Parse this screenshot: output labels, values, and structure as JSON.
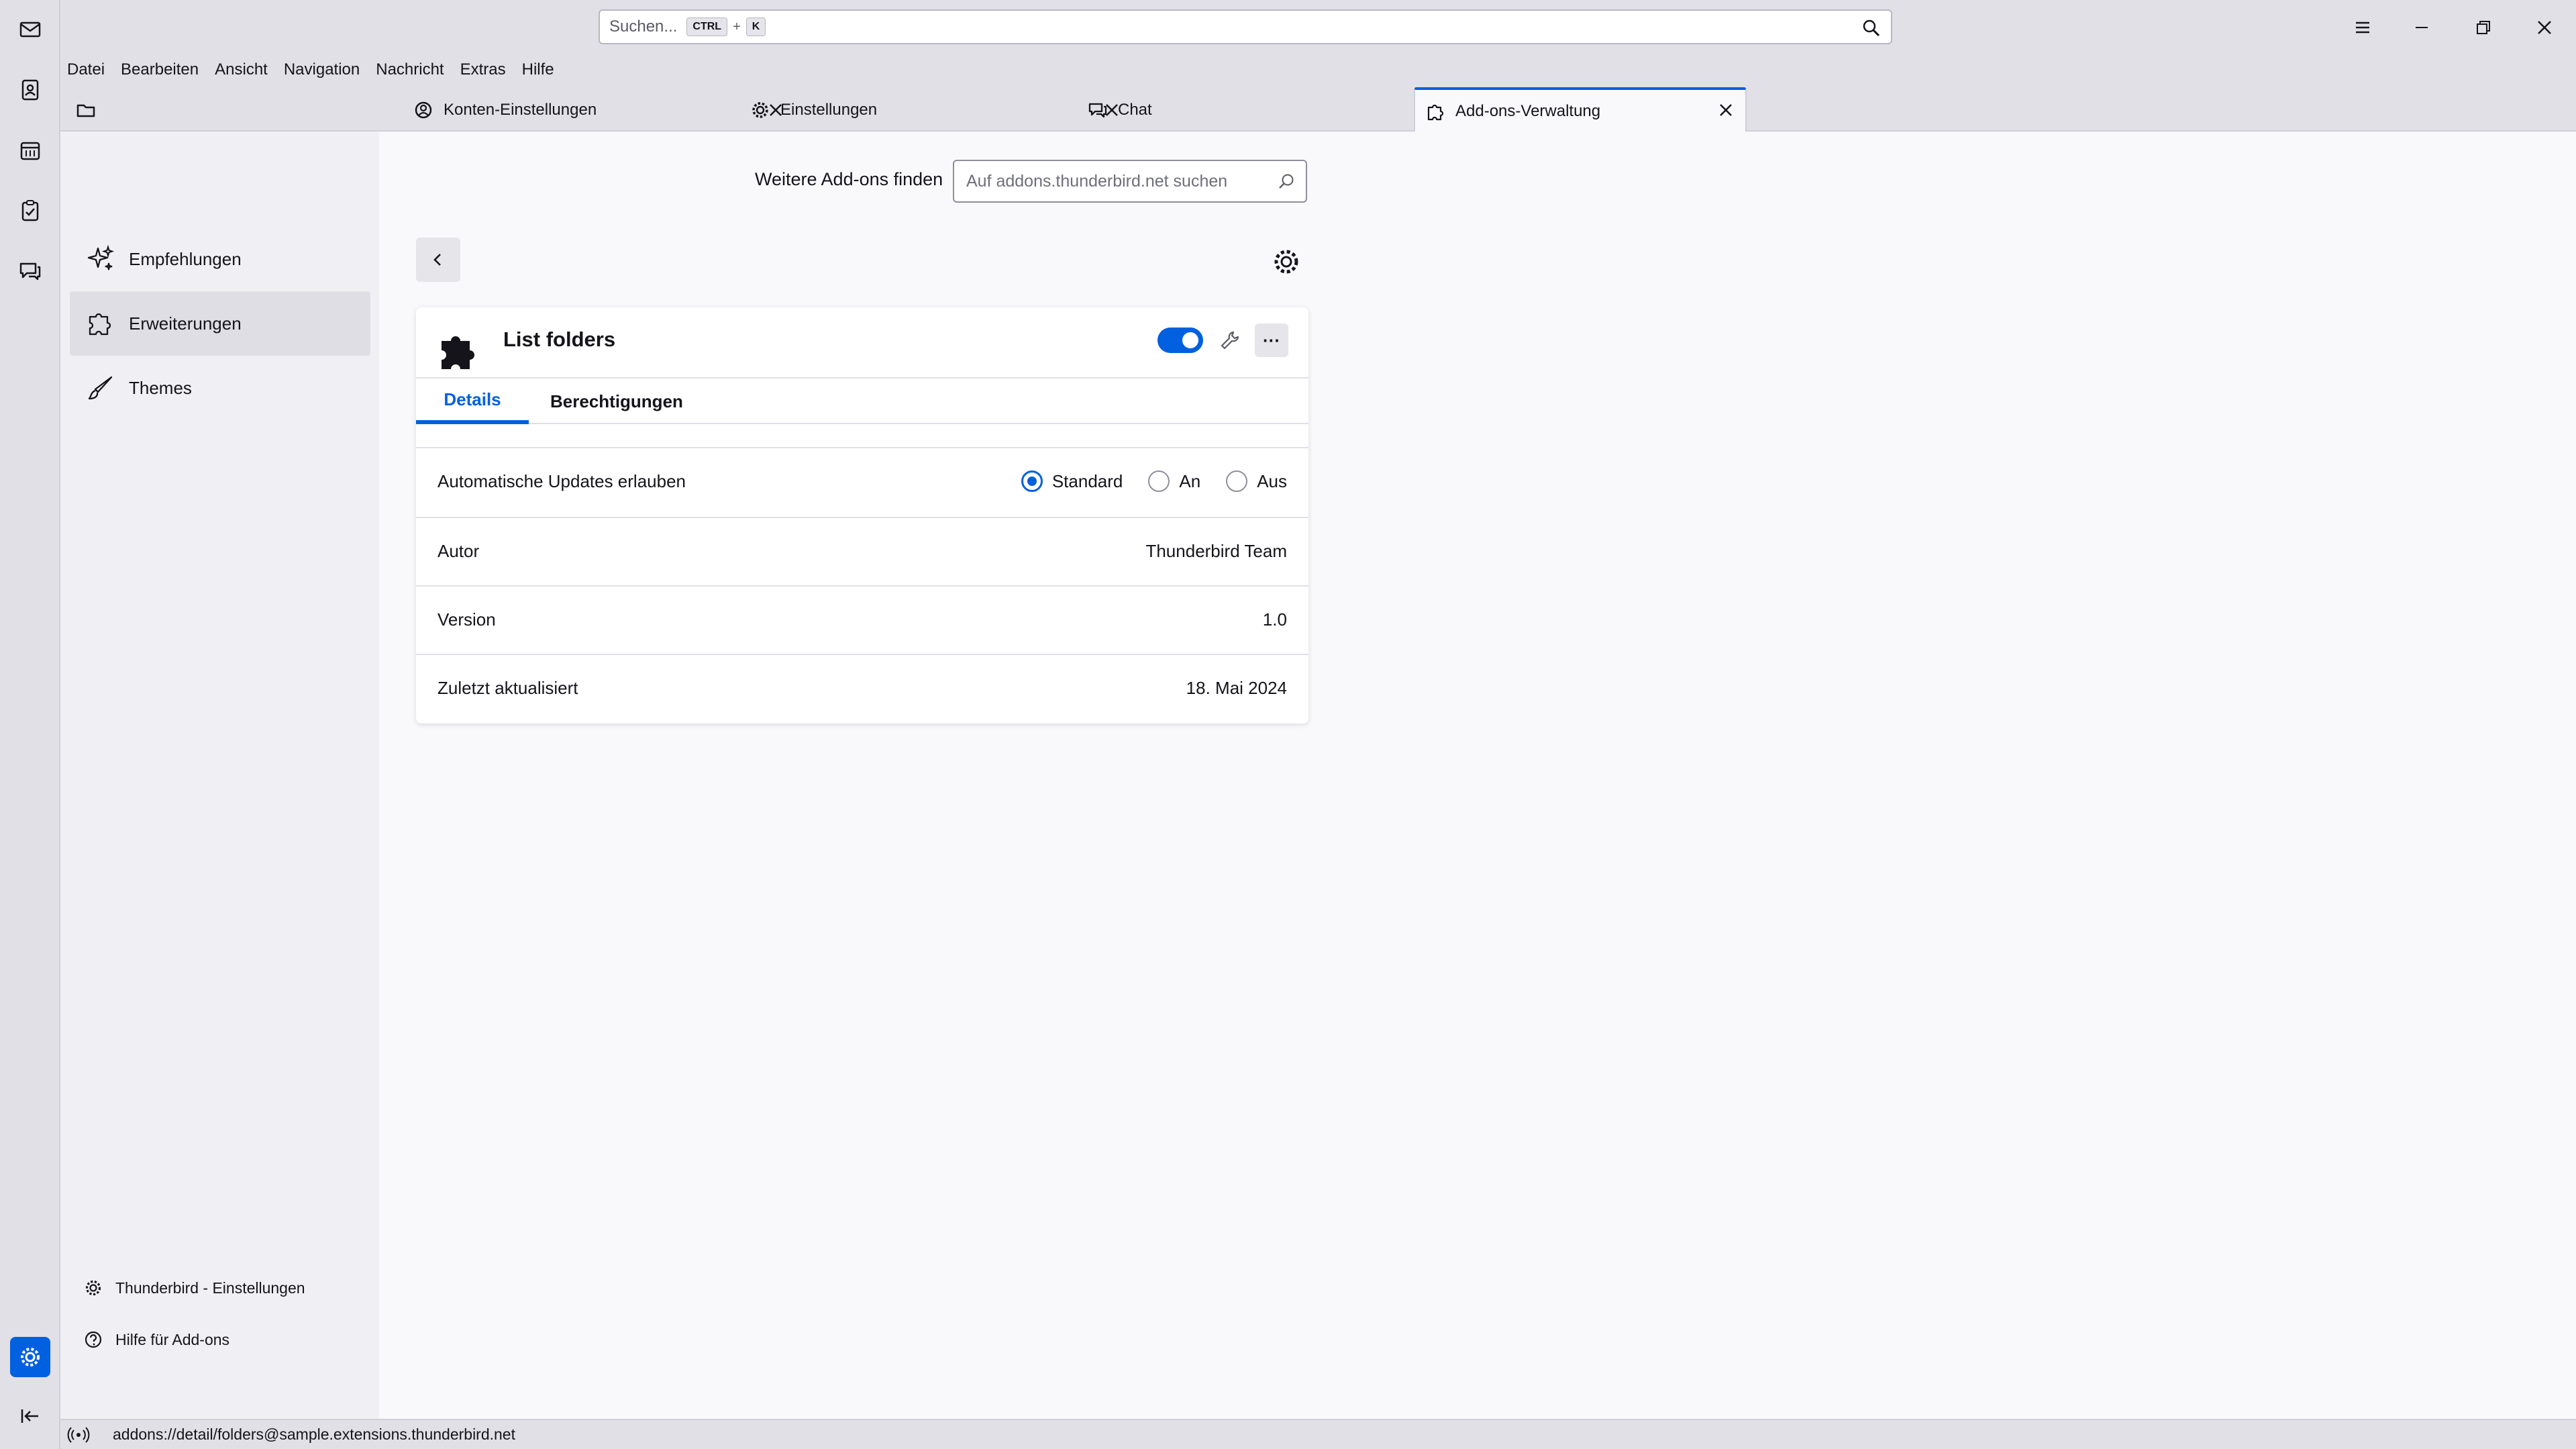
{
  "search": {
    "placeholder": "Suchen...",
    "shortcut_key1": "CTRL",
    "shortcut_plus": "+",
    "shortcut_key2": "K"
  },
  "menubar": {
    "items": [
      "Datei",
      "Bearbeiten",
      "Ansicht",
      "Navigation",
      "Nachricht",
      "Extras",
      "Hilfe"
    ]
  },
  "tabs": [
    {
      "label": "Konten-Einstellungen",
      "icon": "account-settings-icon"
    },
    {
      "label": "Einstellungen",
      "icon": "gear-icon"
    },
    {
      "label": "Chat",
      "icon": "chat-icon"
    },
    {
      "label": "Add-ons-Verwaltung",
      "icon": "puzzle-icon",
      "selected": true
    }
  ],
  "sidebar": {
    "categories": [
      {
        "label": "Empfehlungen",
        "icon": "sparkle-icon"
      },
      {
        "label": "Erweiterungen",
        "icon": "puzzle-icon",
        "active": true
      },
      {
        "label": "Themes",
        "icon": "brush-icon"
      }
    ],
    "footer": [
      {
        "label": "Thunderbird - Einstellungen",
        "icon": "gear-icon"
      },
      {
        "label": "Hilfe für Add-ons",
        "icon": "help-icon"
      }
    ]
  },
  "main": {
    "find_label": "Weitere Add-ons finden",
    "amo_search_placeholder": "Auf addons.thunderbird.net suchen",
    "addon": {
      "name": "List folders",
      "enabled": true,
      "more_label": "···",
      "tabs": [
        "Details",
        "Berechtigungen"
      ],
      "active_tab": "Details",
      "updates": {
        "label": "Automatische Updates erlauben",
        "options": [
          "Standard",
          "An",
          "Aus"
        ],
        "selected": "Standard"
      },
      "details": [
        {
          "label": "Autor",
          "value": "Thunderbird Team"
        },
        {
          "label": "Version",
          "value": "1.0"
        },
        {
          "label": "Zuletzt aktualisiert",
          "value": "18. Mai 2024"
        }
      ]
    }
  },
  "status": {
    "url": "addons://detail/folders@sample.extensions.thunderbird.net"
  },
  "colors": {
    "accent": "#0060df",
    "chrome": "#e0e0e6",
    "sidebar": "#f0f0f4"
  }
}
